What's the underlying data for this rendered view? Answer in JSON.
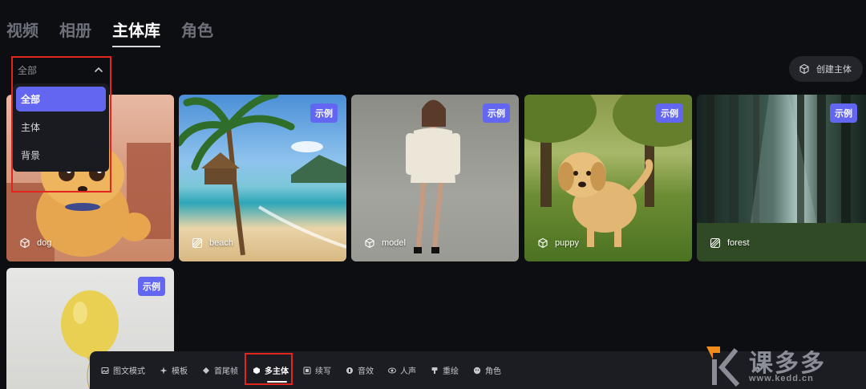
{
  "tabs": [
    {
      "label": "视频",
      "active": false
    },
    {
      "label": "相册",
      "active": false
    },
    {
      "label": "主体库",
      "active": true
    },
    {
      "label": "角色",
      "active": false
    }
  ],
  "filter": {
    "value": "全部",
    "options": [
      "全部",
      "主体",
      "背景"
    ],
    "selected_index": 0
  },
  "create_button": {
    "label": "创建主体",
    "icon": "cube-icon"
  },
  "badge_label": "示例",
  "cards": [
    {
      "label": "dog",
      "icon": "cube-icon"
    },
    {
      "label": "beach",
      "icon": "background-icon"
    },
    {
      "label": "model",
      "icon": "cube-icon"
    },
    {
      "label": "puppy",
      "icon": "cube-icon"
    },
    {
      "label": "forest",
      "icon": "background-icon"
    },
    {
      "label": "",
      "icon": ""
    }
  ],
  "toolbar": [
    {
      "label": "图文模式",
      "icon": "image-icon"
    },
    {
      "label": "模板",
      "icon": "sparkle-icon"
    },
    {
      "label": "首尾帧",
      "icon": "diamond-icon"
    },
    {
      "label": "多主体",
      "icon": "cube-icon",
      "active": true
    },
    {
      "label": "续写",
      "icon": "extend-icon"
    },
    {
      "label": "音效",
      "icon": "sound-icon"
    },
    {
      "label": "人声",
      "icon": "voice-icon"
    },
    {
      "label": "重绘",
      "icon": "brush-icon"
    },
    {
      "label": "角色",
      "icon": "face-icon"
    }
  ],
  "watermark": {
    "brand": "课多多",
    "url": "www.kedd.cn"
  },
  "colors": {
    "accent": "#6366f1",
    "highlight": "#e2261d",
    "background": "#0d0e12"
  }
}
